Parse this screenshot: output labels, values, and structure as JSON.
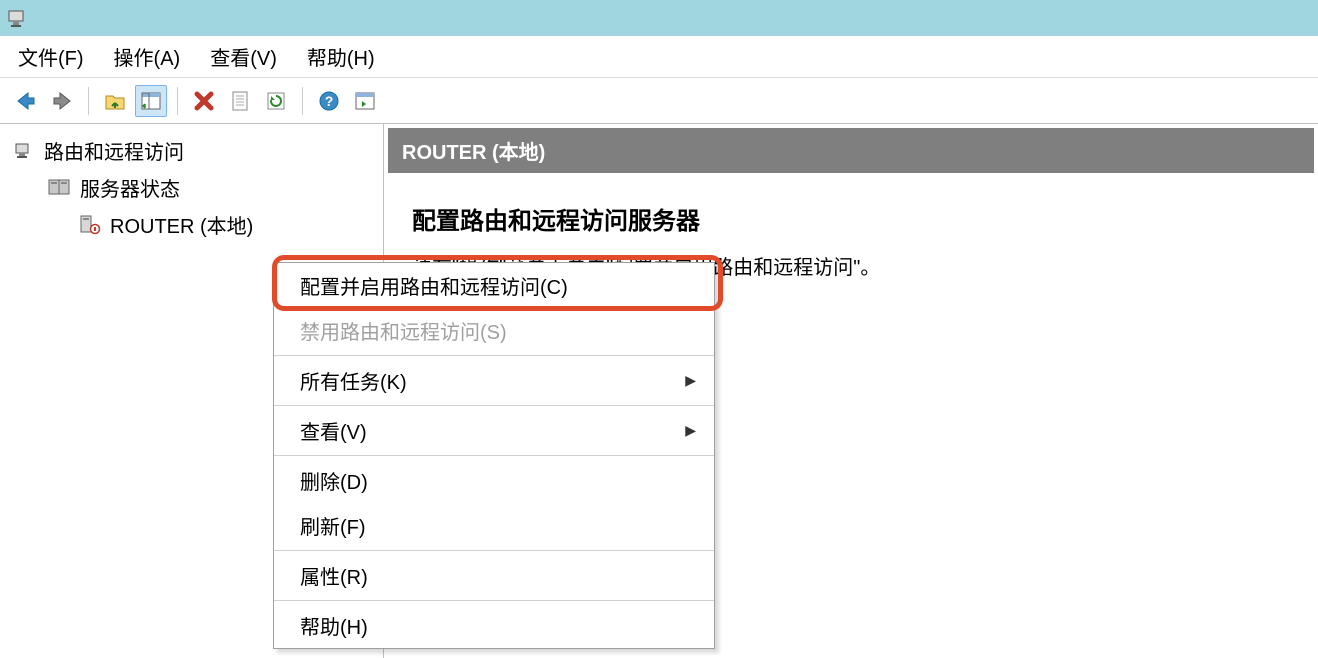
{
  "titlebar": {
    "icon_name": "server-icon"
  },
  "menubar": {
    "items": [
      "文件(F)",
      "操作(A)",
      "查看(V)",
      "帮助(H)"
    ]
  },
  "toolbar": {
    "back_icon": "back-arrow",
    "forward_icon": "forward-arrow",
    "up_icon": "folder-up",
    "details_icon": "details-pane",
    "delete_icon": "delete-x",
    "properties_icon": "properties-sheet",
    "refresh_icon": "refresh",
    "help_icon": "help",
    "showpane_icon": "show-pane"
  },
  "tree": {
    "root": {
      "label": "路由和远程访问"
    },
    "server_status": {
      "label": "服务器状态"
    },
    "router_local": {
      "label": "ROUTER (本地)"
    }
  },
  "content": {
    "header": "ROUTER (本地)",
    "heading": "配置路由和远程访问服务器",
    "text_fragment": "请在\"操作\"菜单上单击\"配置并启用路由和远程访问\"。"
  },
  "context_menu": {
    "configure": "配置并启用路由和远程访问(C)",
    "disable": "禁用路由和远程访问(S)",
    "all_tasks": "所有任务(K)",
    "view": "查看(V)",
    "delete": "删除(D)",
    "refresh": "刷新(F)",
    "properties": "属性(R)",
    "help": "帮助(H)"
  }
}
